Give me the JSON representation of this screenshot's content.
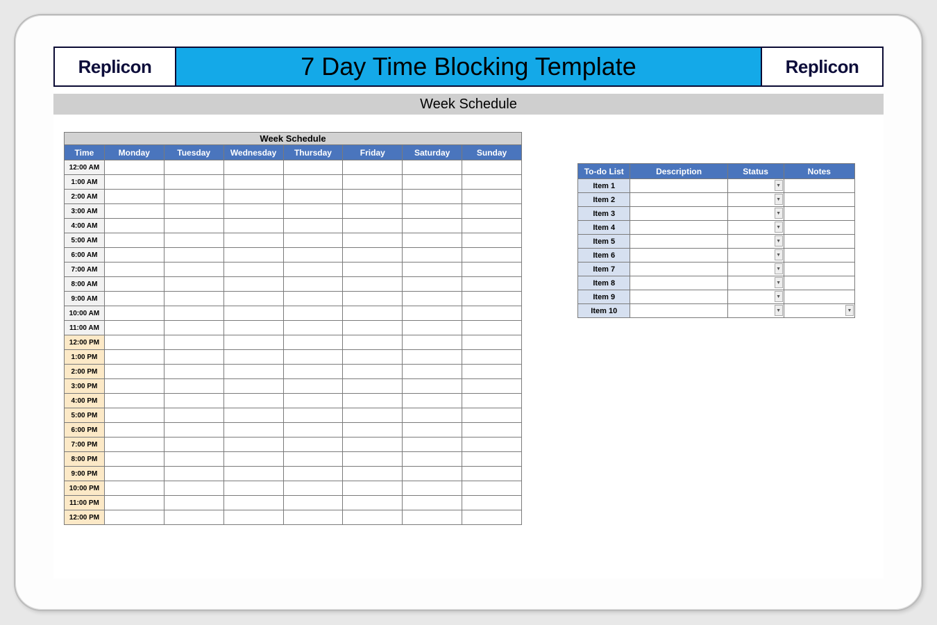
{
  "brand": "Replicon",
  "title": "7 Day Time Blocking Template",
  "subtitle": "Week Schedule",
  "schedule": {
    "caption": "Week Schedule",
    "headers": [
      "Time",
      "Monday",
      "Tuesday",
      "Wednesday",
      "Thursday",
      "Friday",
      "Saturday",
      "Sunday"
    ],
    "rows": [
      {
        "time": "12:00 AM",
        "period": "am"
      },
      {
        "time": "1:00 AM",
        "period": "am"
      },
      {
        "time": "2:00 AM",
        "period": "am"
      },
      {
        "time": "3:00 AM",
        "period": "am"
      },
      {
        "time": "4:00 AM",
        "period": "am"
      },
      {
        "time": "5:00 AM",
        "period": "am"
      },
      {
        "time": "6:00 AM",
        "period": "am"
      },
      {
        "time": "7:00 AM",
        "period": "am"
      },
      {
        "time": "8:00 AM",
        "period": "am"
      },
      {
        "time": "9:00 AM",
        "period": "am"
      },
      {
        "time": "10:00 AM",
        "period": "am"
      },
      {
        "time": "11:00 AM",
        "period": "am"
      },
      {
        "time": "12:00 PM",
        "period": "pm"
      },
      {
        "time": "1:00 PM",
        "period": "pm"
      },
      {
        "time": "2:00 PM",
        "period": "pm"
      },
      {
        "time": "3:00 PM",
        "period": "pm"
      },
      {
        "time": "4:00 PM",
        "period": "pm"
      },
      {
        "time": "5:00 PM",
        "period": "pm"
      },
      {
        "time": "6:00 PM",
        "period": "pm"
      },
      {
        "time": "7:00 PM",
        "period": "pm"
      },
      {
        "time": "8:00 PM",
        "period": "pm"
      },
      {
        "time": "9:00 PM",
        "period": "pm"
      },
      {
        "time": "10:00 PM",
        "period": "pm"
      },
      {
        "time": "11:00 PM",
        "period": "pm"
      },
      {
        "time": "12:00 PM",
        "period": "pm"
      }
    ]
  },
  "todo": {
    "headers": [
      "To-do List",
      "Description",
      "Status",
      "Notes"
    ],
    "items": [
      "Item 1",
      "Item 2",
      "Item 3",
      "Item 4",
      "Item 5",
      "Item 6",
      "Item 7",
      "Item 8",
      "Item 9",
      "Item 10"
    ]
  }
}
